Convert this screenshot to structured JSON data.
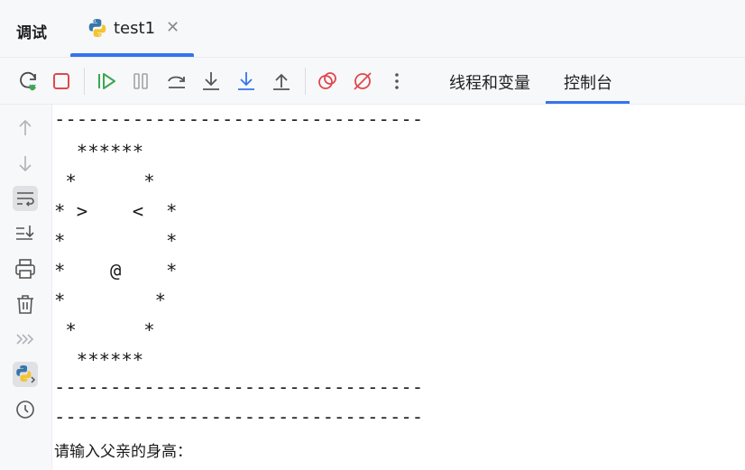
{
  "panel": {
    "title": "调试"
  },
  "tab": {
    "label": "test1",
    "close_glyph": "✕",
    "icon": "python-icon"
  },
  "toolbar": {
    "buttons": [
      {
        "name": "rerun-debug-icon",
        "color": "#4a4a4a"
      },
      {
        "name": "stop-icon",
        "color": "#e0484c"
      },
      {
        "name": "resume-icon",
        "color": "#3ea653"
      },
      {
        "name": "pause-icon",
        "color": "#a0a3a8"
      },
      {
        "name": "step-over-icon",
        "color": "#555555"
      },
      {
        "name": "step-into-icon",
        "color": "#555555"
      },
      {
        "name": "step-into-my-code-icon",
        "color": "#3574f0"
      },
      {
        "name": "step-out-icon",
        "color": "#555555"
      },
      {
        "name": "view-breakpoints-icon",
        "color": "#e0484c"
      },
      {
        "name": "mute-breakpoints-icon",
        "color": "#e0484c"
      },
      {
        "name": "more-icon",
        "color": "#555555"
      }
    ],
    "tabs": [
      {
        "label": "线程和变量",
        "active": false
      },
      {
        "label": "控制台",
        "active": true
      }
    ]
  },
  "side": {
    "buttons": [
      {
        "name": "up-arrow-icon"
      },
      {
        "name": "down-arrow-icon"
      },
      {
        "name": "soft-wrap-icon",
        "active": true
      },
      {
        "name": "scroll-to-end-icon"
      },
      {
        "name": "print-icon"
      },
      {
        "name": "trash-icon"
      },
      {
        "name": "expand-chevrons-icon"
      },
      {
        "name": "python-console-icon",
        "active": true
      },
      {
        "name": "history-icon"
      }
    ]
  },
  "console": {
    "lines": [
      "---------------------------------",
      "  ******",
      " *      *",
      "* >    <  *",
      "*         *",
      "*    @    *",
      "*        *",
      " *      *",
      "  ******",
      "---------------------------------",
      "---------------------------------"
    ],
    "prompt": "请输入父亲的身高："
  }
}
